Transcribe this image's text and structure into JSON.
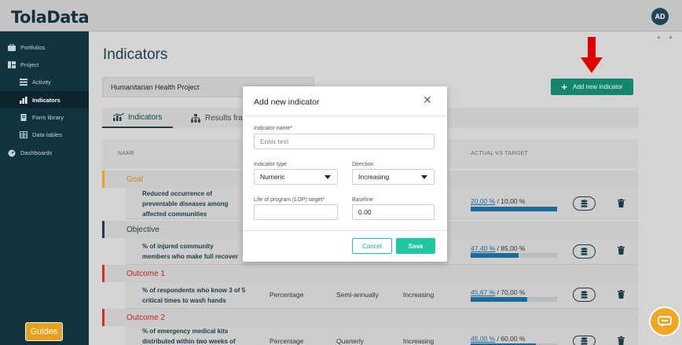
{
  "app": {
    "logo": "TolaData",
    "user_initials": "AD"
  },
  "sidebar": {
    "items": [
      {
        "label": "Portfolios",
        "icon": "briefcase-icon"
      },
      {
        "label": "Project",
        "icon": "project-icon"
      },
      {
        "label": "Activity",
        "icon": "list-icon"
      },
      {
        "label": "Indicators",
        "icon": "bar-chart-icon"
      },
      {
        "label": "Form library",
        "icon": "document-icon"
      },
      {
        "label": "Data tables",
        "icon": "table-icon"
      },
      {
        "label": "Dashboards",
        "icon": "dashboard-icon"
      }
    ],
    "guides_label": "Guides"
  },
  "main": {
    "title": "Indicators",
    "project_select": "Humanitarian Health Project",
    "add_button": "Add new indicator",
    "tabs": [
      {
        "label": "Indicators"
      },
      {
        "label": "Results fram"
      }
    ],
    "table": {
      "headers": {
        "name": "NAME",
        "actual_vs_target": "ACTUAL VS TARGET"
      },
      "groups": [
        {
          "label": "Goal",
          "color": "#e9a11d"
        },
        {
          "label": "Objective",
          "color": "#1c3c48"
        },
        {
          "label": "Outcome 1",
          "color": "#d42a2a"
        },
        {
          "label": "Outcome 2",
          "color": "#d42a2a"
        }
      ],
      "rows": [
        {
          "name_lines": [
            "Reduced occurrence of",
            "preventable diseases among",
            "affected communities"
          ],
          "type": "",
          "frequency": "",
          "direction": "",
          "actual": "20,00 %",
          "target": " / 10,00 %",
          "progress": 1.0
        },
        {
          "name_lines": [
            "% of injured community",
            "members who make full recover"
          ],
          "type": "",
          "frequency": "",
          "direction": "",
          "actual": "47,40 %",
          "target": " / 85,00 %",
          "progress": 0.557
        },
        {
          "name_lines": [
            "% of respondents who know 3 of 5",
            "critical times to wash hands"
          ],
          "type": "Percentage",
          "frequency": "Semi-annually",
          "direction": "Increasing",
          "actual": "45,67 %",
          "target": " / 70,00 %",
          "progress": 0.652
        },
        {
          "name_lines": [
            "% of emergency medical kits",
            "distributed within two weeks of"
          ],
          "type": "Percentage",
          "frequency": "Quarterly",
          "direction": "Increasing",
          "actual": "45,00 %",
          "target": " / 60,00 %",
          "progress": 0.75
        }
      ]
    }
  },
  "modal": {
    "title": "Add new indicator",
    "name_label": "Indicator name*",
    "name_placeholder": "Enter text",
    "type_label": "Indicator type",
    "type_value": "Numeric",
    "direction_label": "Direction",
    "direction_value": "Increasing",
    "lop_label": "Life of program (LOP) target*",
    "lop_value": "",
    "baseline_label": "Baseline",
    "baseline_value": "0.00",
    "cancel_label": "Cancel",
    "save_label": "Save"
  },
  "colors": {
    "primary": "#15866e",
    "modal_accent": "#1ec8a0",
    "sidebar": "#10333f",
    "progress": "#1b6a9a",
    "arrow": "#e00000"
  }
}
